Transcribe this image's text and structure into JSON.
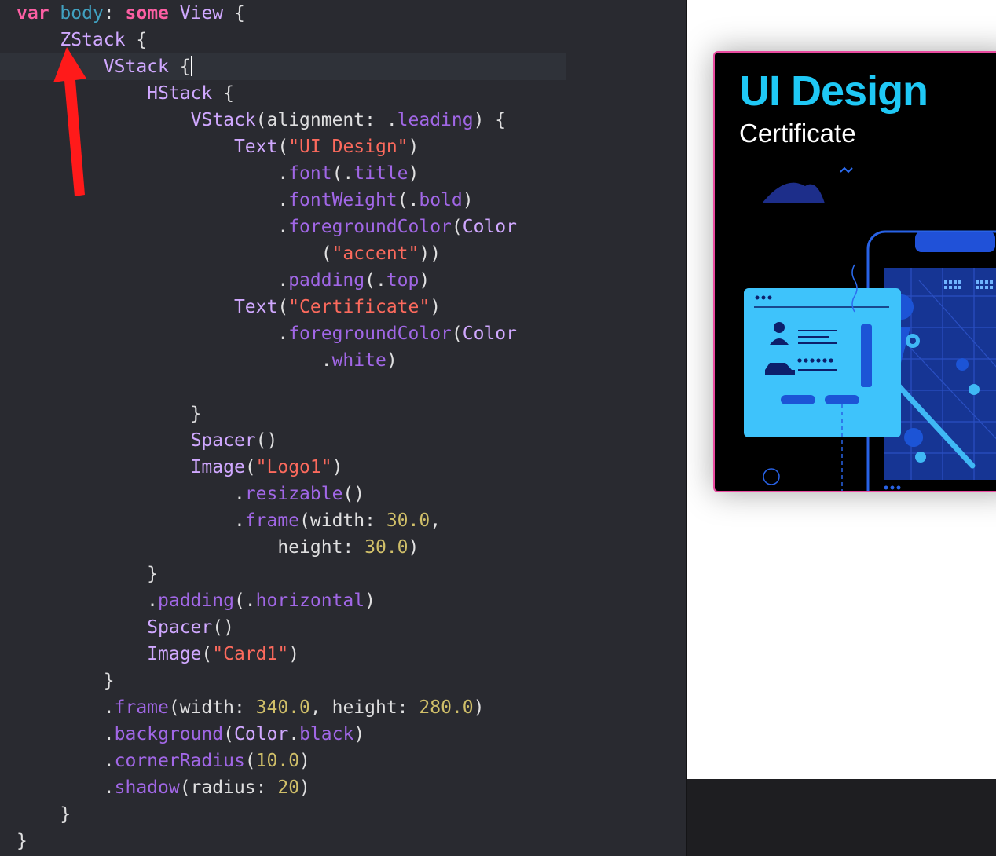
{
  "editor": {
    "lines": [
      {
        "tokens": [
          [
            "kw",
            "var"
          ],
          [
            "plain",
            " "
          ],
          [
            "decl",
            "body"
          ],
          [
            "plain",
            ": "
          ],
          [
            "kw",
            "some"
          ],
          [
            "plain",
            " "
          ],
          [
            "type",
            "View"
          ],
          [
            "plain",
            " {"
          ]
        ]
      },
      {
        "tokens": [
          [
            "plain",
            "    "
          ],
          [
            "type",
            "ZStack"
          ],
          [
            "plain",
            " {"
          ]
        ]
      },
      {
        "tokens": [
          [
            "plain",
            "        "
          ],
          [
            "type",
            "VStack"
          ],
          [
            "plain",
            " {"
          ]
        ]
      },
      {
        "tokens": [
          [
            "plain",
            "            "
          ],
          [
            "type",
            "HStack"
          ],
          [
            "plain",
            " {"
          ]
        ]
      },
      {
        "tokens": [
          [
            "plain",
            "                "
          ],
          [
            "type",
            "VStack"
          ],
          [
            "plain",
            "(alignment: ."
          ],
          [
            "mem",
            "leading"
          ],
          [
            "plain",
            ") {"
          ]
        ]
      },
      {
        "tokens": [
          [
            "plain",
            "                    "
          ],
          [
            "type",
            "Text"
          ],
          [
            "plain",
            "("
          ],
          [
            "str",
            "\"UI Design\""
          ],
          [
            "plain",
            ")"
          ]
        ]
      },
      {
        "tokens": [
          [
            "plain",
            "                        ."
          ],
          [
            "mem",
            "font"
          ],
          [
            "plain",
            "(."
          ],
          [
            "mem",
            "title"
          ],
          [
            "plain",
            ")"
          ]
        ]
      },
      {
        "tokens": [
          [
            "plain",
            "                        ."
          ],
          [
            "mem",
            "fontWeight"
          ],
          [
            "plain",
            "(."
          ],
          [
            "mem",
            "bold"
          ],
          [
            "plain",
            ")"
          ]
        ]
      },
      {
        "tokens": [
          [
            "plain",
            "                        ."
          ],
          [
            "mem",
            "foregroundColor"
          ],
          [
            "plain",
            "("
          ],
          [
            "type",
            "Color"
          ]
        ]
      },
      {
        "tokens": [
          [
            "plain",
            "                            ("
          ],
          [
            "str",
            "\"accent\""
          ],
          [
            "plain",
            "))"
          ]
        ]
      },
      {
        "tokens": [
          [
            "plain",
            "                        ."
          ],
          [
            "mem",
            "padding"
          ],
          [
            "plain",
            "(."
          ],
          [
            "mem",
            "top"
          ],
          [
            "plain",
            ")"
          ]
        ]
      },
      {
        "tokens": [
          [
            "plain",
            "                    "
          ],
          [
            "type",
            "Text"
          ],
          [
            "plain",
            "("
          ],
          [
            "str",
            "\"Certificate\""
          ],
          [
            "plain",
            ")"
          ]
        ]
      },
      {
        "tokens": [
          [
            "plain",
            "                        ."
          ],
          [
            "mem",
            "foregroundColor"
          ],
          [
            "plain",
            "("
          ],
          [
            "type",
            "Color"
          ]
        ]
      },
      {
        "tokens": [
          [
            "plain",
            "                            ."
          ],
          [
            "mem",
            "white"
          ],
          [
            "plain",
            ")"
          ]
        ]
      },
      {
        "tokens": []
      },
      {
        "tokens": [
          [
            "plain",
            "                }"
          ]
        ]
      },
      {
        "tokens": [
          [
            "plain",
            "                "
          ],
          [
            "type",
            "Spacer"
          ],
          [
            "plain",
            "()"
          ]
        ]
      },
      {
        "tokens": [
          [
            "plain",
            "                "
          ],
          [
            "type",
            "Image"
          ],
          [
            "plain",
            "("
          ],
          [
            "str",
            "\"Logo1\""
          ],
          [
            "plain",
            ")"
          ]
        ]
      },
      {
        "tokens": [
          [
            "plain",
            "                    ."
          ],
          [
            "mem",
            "resizable"
          ],
          [
            "plain",
            "()"
          ]
        ]
      },
      {
        "tokens": [
          [
            "plain",
            "                    ."
          ],
          [
            "mem",
            "frame"
          ],
          [
            "plain",
            "(width: "
          ],
          [
            "num",
            "30.0"
          ],
          [
            "plain",
            ","
          ]
        ]
      },
      {
        "tokens": [
          [
            "plain",
            "                        height: "
          ],
          [
            "num",
            "30.0"
          ],
          [
            "plain",
            ")"
          ]
        ]
      },
      {
        "tokens": [
          [
            "plain",
            "            }"
          ]
        ]
      },
      {
        "tokens": [
          [
            "plain",
            "            ."
          ],
          [
            "mem",
            "padding"
          ],
          [
            "plain",
            "(."
          ],
          [
            "mem",
            "horizontal"
          ],
          [
            "plain",
            ")"
          ]
        ]
      },
      {
        "tokens": [
          [
            "plain",
            "            "
          ],
          [
            "type",
            "Spacer"
          ],
          [
            "plain",
            "()"
          ]
        ]
      },
      {
        "tokens": [
          [
            "plain",
            "            "
          ],
          [
            "type",
            "Image"
          ],
          [
            "plain",
            "("
          ],
          [
            "str",
            "\"Card1\""
          ],
          [
            "plain",
            ")"
          ]
        ]
      },
      {
        "tokens": [
          [
            "plain",
            "        }"
          ]
        ]
      },
      {
        "tokens": [
          [
            "plain",
            "        ."
          ],
          [
            "mem",
            "frame"
          ],
          [
            "plain",
            "(width: "
          ],
          [
            "num",
            "340.0"
          ],
          [
            "plain",
            ", height: "
          ],
          [
            "num",
            "280.0"
          ],
          [
            "plain",
            ")"
          ]
        ]
      },
      {
        "tokens": [
          [
            "plain",
            "        ."
          ],
          [
            "mem",
            "background"
          ],
          [
            "plain",
            "("
          ],
          [
            "type",
            "Color"
          ],
          [
            "plain",
            "."
          ],
          [
            "mem",
            "black"
          ],
          [
            "plain",
            ")"
          ]
        ]
      },
      {
        "tokens": [
          [
            "plain",
            "        ."
          ],
          [
            "mem",
            "cornerRadius"
          ],
          [
            "plain",
            "("
          ],
          [
            "num",
            "10.0"
          ],
          [
            "plain",
            ")"
          ]
        ]
      },
      {
        "tokens": [
          [
            "plain",
            "        ."
          ],
          [
            "mem",
            "shadow"
          ],
          [
            "plain",
            "(radius: "
          ],
          [
            "num",
            "20"
          ],
          [
            "plain",
            ")"
          ]
        ]
      },
      {
        "tokens": [
          [
            "plain",
            "    }"
          ]
        ]
      },
      {
        "tokens": [
          [
            "plain",
            "}"
          ]
        ]
      }
    ],
    "caret_line": 2,
    "annotation": {
      "icon": "red-arrow-icon",
      "color": "#ff1a1a",
      "points_to": "ZStack"
    }
  },
  "preview": {
    "card": {
      "title": "UI Design",
      "subtitle": "Certificate",
      "illustration_icon": "map-app-illustration-icon",
      "title_color": "#1fc8f5",
      "border_color": "#e94ba0"
    }
  }
}
